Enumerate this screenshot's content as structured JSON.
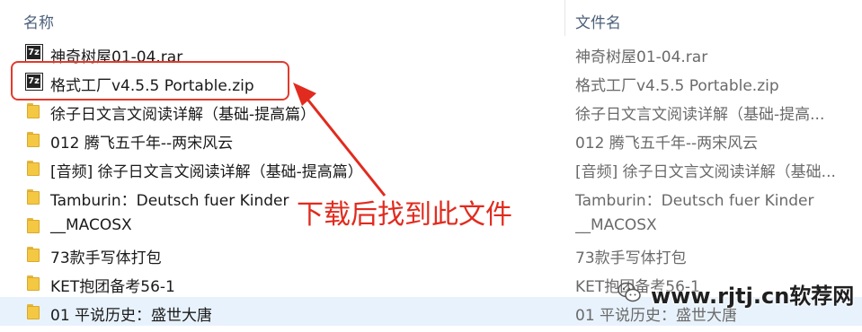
{
  "header": {
    "col_name": "名称",
    "col_filename": "文件名"
  },
  "rows": [
    {
      "name": "神奇树屋01-04.rar",
      "filename": "神奇树屋01-04.rar",
      "icon": "7z-archive-icon"
    },
    {
      "name": "格式工厂v4.5.5 Portable.zip",
      "filename": "格式工厂v4.5.5 Portable.zip",
      "icon": "7z-archive-icon"
    },
    {
      "name": "徐子日文言文阅读详解（基础-提高篇）",
      "filename": "徐子日文言文阅读详解（基础-提高...",
      "icon": "folder-icon"
    },
    {
      "name": "012  腾飞五千年--两宋风云",
      "filename": "012  腾飞五千年--两宋风云",
      "icon": "folder-icon"
    },
    {
      "name": "[音频] 徐子日文言文阅读详解（基础-提高篇）",
      "filename": "[音频] 徐子日文言文阅读详解（基础...",
      "icon": "folder-icon"
    },
    {
      "name": "Tamburin：Deutsch fuer Kinder",
      "filename": "Tamburin：Deutsch fuer Kinder",
      "icon": "folder-icon"
    },
    {
      "name": "__MACOSX",
      "filename": "__MACOSX",
      "icon": "folder-icon"
    },
    {
      "name": "73款手写体打包",
      "filename": "73款手写体打包",
      "icon": "folder-icon"
    },
    {
      "name": "KET抱团备考56-1",
      "filename": "KET抱团备考56-1",
      "icon": "folder-icon"
    },
    {
      "name": "01 平说历史：盛世大唐",
      "filename": "01 平说历史：盛世大唐",
      "icon": "folder-icon"
    }
  ],
  "annotation": {
    "text": "下载后找到此文件",
    "color": "#e12b1e"
  },
  "watermark": {
    "text": "www.rjtj.cn软荐网",
    "icon": "wechat-icon"
  },
  "colors": {
    "selected_row": "#e8f2fc",
    "folder": "#f4c842",
    "highlight": "#e23a2c"
  }
}
